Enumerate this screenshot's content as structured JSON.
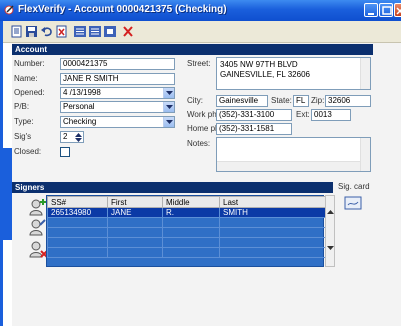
{
  "window": {
    "title": "FlexVerify - Account 0000421375 (Checking)"
  },
  "sections": {
    "account": "Account",
    "signers": "Signers"
  },
  "account": {
    "number_label": "Number:",
    "number_value": "0000421375",
    "name_label": "Name:",
    "name_value": "JANE R SMITH",
    "opened_label": "Opened:",
    "opened_value": "4 /13/1998",
    "pb_label": "P/B:",
    "pb_value": "Personal",
    "type_label": "Type:",
    "type_value": "Checking",
    "sigs_label": "Sig's",
    "sigs_value": "2",
    "closed_label": "Closed:",
    "street_label": "Street:",
    "street_line1": "3405 NW 97TH BLVD",
    "street_line2": "GAINESVILLE, FL 32606",
    "city_label": "City:",
    "city_value": "Gainesville",
    "state_label": "State:",
    "state_value": "FL",
    "zip_label": "Zip:",
    "zip_value": "32606",
    "workph_label": "Work ph:",
    "workph_value": "(352)-331-3100",
    "ext_label": "Ext:",
    "ext_value": "0013",
    "homeph_label": "Home ph:",
    "homeph_value": "(352)-331-1581",
    "notes_label": "Notes:"
  },
  "signers": {
    "sigcard_label": "Sig. card",
    "columns": [
      "SS#",
      "First",
      "Middle",
      "Last"
    ],
    "rows": [
      {
        "ssn": "265134980",
        "first": "JANE",
        "middle": "R.",
        "last": "SMITH"
      }
    ]
  }
}
